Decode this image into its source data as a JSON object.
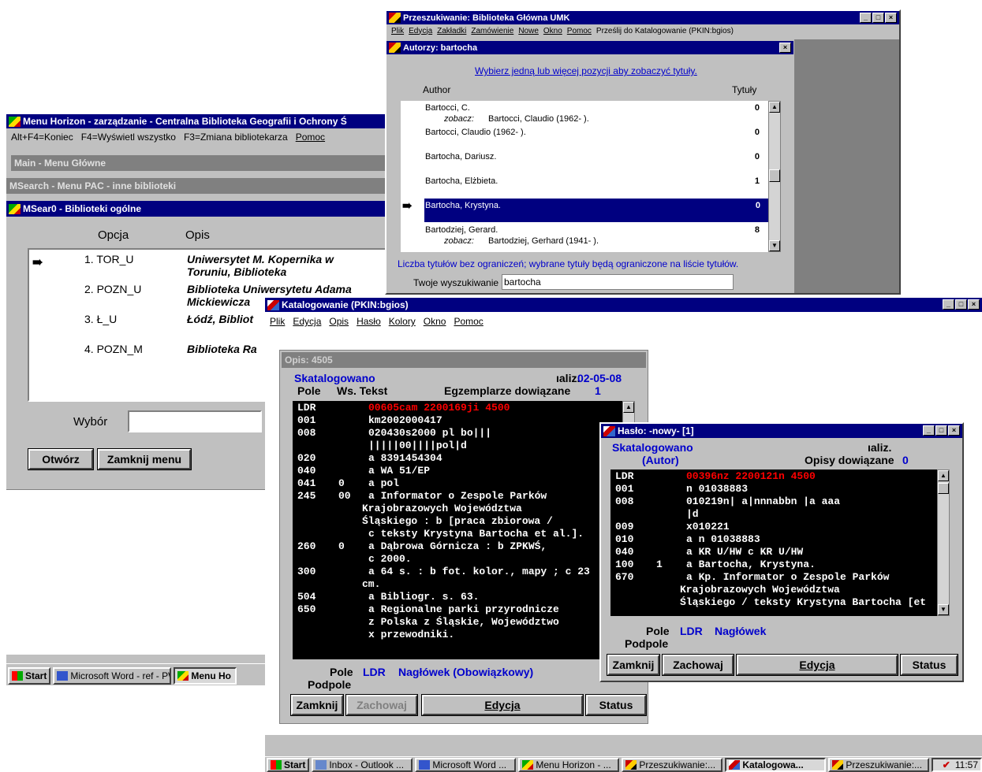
{
  "colors": {
    "title_bar": "#000080",
    "window_bg": "#c0c0c0",
    "selection": "#000080",
    "link": "#0000cc",
    "marc_bg": "#000000",
    "marc_red": "#ff0000"
  },
  "menu_horizon": {
    "title": "Menu Horizon - zarządzanie - Centralna Biblioteka Geografii i Ochrony Ś",
    "shortcuts": [
      "Alt+F4=Koniec",
      "F4=Wyświetl wszystko",
      "F3=Zmiana bibliotekarza",
      "Pomoc"
    ],
    "levels": [
      "Main - Menu Główne",
      "MSearch - Menu PAC - inne biblioteki"
    ],
    "sub_title": "MSear0 - Biblioteki ogólne",
    "col_option": "Opcja",
    "col_desc": "Opis",
    "rows": [
      {
        "opt": "1. TOR_U",
        "desc1": "Uniwersytet M. Kopernika w",
        "desc2": "Toruniu, Biblioteka"
      },
      {
        "opt": "2. POZN_U",
        "desc1": "Biblioteka Uniwersytetu Adama",
        "desc2": "Mickiewicza"
      },
      {
        "opt": "3. Ł_U",
        "desc1": "Łódź, Bibliot",
        "desc2": ""
      },
      {
        "opt": "4. POZN_M",
        "desc1": "Biblioteka Ra",
        "desc2": ""
      }
    ],
    "wybor_label": "Wybór",
    "btn_open": "Otwórz",
    "btn_close": "Zamknij menu"
  },
  "left_taskbar": {
    "start": "Start",
    "items": [
      "Microsoft Word - ref - PW-...",
      "Menu Ho"
    ]
  },
  "przeszukiwanie": {
    "title": "Przeszukiwanie: Biblioteka Główna UMK",
    "menu": [
      "Plik",
      "Edycja",
      "Zakładki",
      "Zamówienie",
      "Nowe",
      "Okno",
      "Pomoc",
      "Prześlij do Katalogowanie (PKIN:bgios)"
    ],
    "child_title": "Autorzy: bartocha",
    "instruction": "Wybierz jedną lub więcej pozycji aby zobaczyć tytuły.",
    "col_author": "Author",
    "col_titles": "Tytuły",
    "authors": [
      {
        "name": "Bartocci, C.",
        "count": "0",
        "see_label": "zobacz:",
        "see": "Bartocci, Claudio (1962- )."
      },
      {
        "name": "Bartocci, Claudio (1962- ).",
        "count": "0"
      },
      {
        "name": "Bartocha, Dariusz.",
        "count": "0"
      },
      {
        "name": "Bartocha, Elżbieta.",
        "count": "1"
      },
      {
        "name": "Bartocha, Krystyna.",
        "count": "0"
      },
      {
        "name": "Bartodziej, Gerard.",
        "count": "8",
        "see_label": "zobacz:",
        "see": "Bartodziej, Gerhard (1941- )."
      }
    ],
    "note": "Liczba tytułów bez ograniczeń; wybrane tytuły będą ograniczone na liście tytułów.",
    "search_label": "Twoje wyszukiwanie",
    "search_value": "bartocha"
  },
  "katalogowanie": {
    "title": "Katalogowanie (PKIN:bgios)",
    "menu": [
      "Plik",
      "Edycja",
      "Opis",
      "Hasło",
      "Kolory",
      "Okno",
      "Pomoc"
    ],
    "opis": {
      "header": "Opis: 4505",
      "status": "Skatalogowano",
      "aktualiz": "ıaliz.",
      "date": "02-05-08",
      "col_pole": "Pole",
      "col_ws": "Ws. Tekst",
      "egz_label": "Egzemplarze dowiązane",
      "egz": "1",
      "records": [
        {
          "tag": "LDR",
          "ind": "",
          "text": "00605cam  2200169ji 4500",
          "red": true
        },
        {
          "tag": "001",
          "ind": "",
          "text": "km2002000417"
        },
        {
          "tag": "008",
          "ind": "",
          "text": "020430s2000   pl bo|||"
        },
        {
          "tag": "",
          "ind": "",
          "text": "|||||00||||pol|d"
        },
        {
          "tag": "020",
          "ind": "",
          "text": "a 8391454304"
        },
        {
          "tag": "040",
          "ind": "",
          "text": "a WA 51/EP"
        },
        {
          "tag": "041",
          "ind": "0",
          "text": "a pol"
        },
        {
          "tag": "245",
          "ind": "00",
          "text": "a Informator o Zespole Parków"
        },
        {
          "tag": "",
          "ind": "",
          "text": "Krajobrazowych Województwa",
          "wrap": true
        },
        {
          "tag": "",
          "ind": "",
          "text": "Śląskiego :   b [praca zbiorowa /",
          "wrap": true
        },
        {
          "tag": "",
          "ind": "",
          "text": "c teksty Krystyna Bartocha et al.]."
        },
        {
          "tag": "260",
          "ind": "0",
          "text": "a Dąbrowa Górnicza :   b ZPKWŚ,"
        },
        {
          "tag": "",
          "ind": "",
          "text": "c 2000."
        },
        {
          "tag": "300",
          "ind": "",
          "text": "a 64 s. :   b fot. kolor., mapy ;   c 23"
        },
        {
          "tag": "",
          "ind": "",
          "text": "cm.",
          "wrap": true
        },
        {
          "tag": "504",
          "ind": "",
          "text": "a Bibliogr. s. 63."
        },
        {
          "tag": "650",
          "ind": "",
          "text": "a Regionalne parki przyrodnicze"
        },
        {
          "tag": "",
          "ind": "",
          "text": "z Polska   z Śląskie, Województwo"
        },
        {
          "tag": "",
          "ind": "",
          "text": "x przewodniki."
        }
      ],
      "pole_label": "Pole",
      "pole_tag": "LDR",
      "pole_desc": "Nagłówek (Obowiązkowy)",
      "podpole": "Podpole",
      "btns": [
        "Zamknij",
        "Zachowaj",
        "Edycja",
        "Status"
      ]
    },
    "haslo": {
      "title": "Hasło: -nowy- [1]",
      "status": "Skatalogowano",
      "aktualiz": "ıaliz.",
      "type": "(Autor)",
      "opisy_label": "Opisy dowiązane",
      "opisy": "0",
      "records": [
        {
          "tag": "LDR",
          "ind": "",
          "text": "00396nz  2200121n  4500",
          "red": true
        },
        {
          "tag": "001",
          "ind": "",
          "text": "n 01038883"
        },
        {
          "tag": "008",
          "ind": "",
          "text": "010219n| a|nnnabbn        |a aaa"
        },
        {
          "tag": "",
          "ind": "",
          "text": "|d"
        },
        {
          "tag": "009",
          "ind": "",
          "text": "x010221"
        },
        {
          "tag": "010",
          "ind": "",
          "text": "a n 01038883"
        },
        {
          "tag": "040",
          "ind": "",
          "text": "a KR U/HW    c KR U/HW"
        },
        {
          "tag": "100",
          "ind": "1",
          "text": "a Bartocha, Krystyna."
        },
        {
          "tag": "670",
          "ind": "",
          "text": "a Kp. Informator o Zespole Parków"
        },
        {
          "tag": "",
          "ind": "",
          "text": "Krajobrazowych Województwa",
          "wrap": true
        },
        {
          "tag": "",
          "ind": "",
          "text": "Śląskiego / teksty Krystyna Bartocha [et",
          "wrap": true
        }
      ],
      "pole_label": "Pole",
      "pole_tag": "LDR",
      "pole_desc": "Nagłówek",
      "podpole": "Podpole",
      "btns": [
        "Zamknij",
        "Zachowaj",
        "Edycja",
        "Status"
      ]
    }
  },
  "taskbar": {
    "start": "Start",
    "items": [
      "Inbox - Outlook ...",
      "Microsoft Word ...",
      "Menu Horizon - ...",
      "Przeszukiwanie:...",
      "Katalogowa...",
      "Przeszukiwanie:..."
    ],
    "active": 4,
    "time": "11:57"
  }
}
